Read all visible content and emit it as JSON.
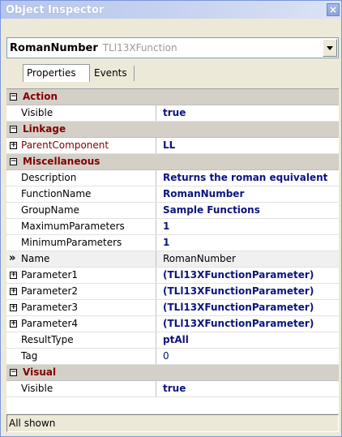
{
  "window": {
    "title": "Object Inspector"
  },
  "object_selector": {
    "name": "RomanNumber",
    "type": "TLl13XFunction"
  },
  "tabs": [
    {
      "label": "Properties"
    },
    {
      "label": "Events"
    }
  ],
  "rows": [
    {
      "kind": "category",
      "toggle": "−",
      "name": "Action"
    },
    {
      "kind": "prop",
      "name": "Visible",
      "value": "true",
      "style": "bold"
    },
    {
      "kind": "category",
      "toggle": "−",
      "name": "Linkage"
    },
    {
      "kind": "prop",
      "toggle": "+",
      "name": "ParentComponent",
      "value": "LL",
      "style": "bold",
      "link": true
    },
    {
      "kind": "category",
      "toggle": "−",
      "name": "Miscellaneous"
    },
    {
      "kind": "prop",
      "name": "Description",
      "value": "Returns the roman equivalent",
      "style": "bold"
    },
    {
      "kind": "prop",
      "name": "FunctionName",
      "value": "RomanNumber",
      "style": "bold"
    },
    {
      "kind": "prop",
      "name": "GroupName",
      "value": "Sample Functions",
      "style": "bold"
    },
    {
      "kind": "prop",
      "name": "MaximumParameters",
      "value": "1",
      "style": "bold"
    },
    {
      "kind": "prop",
      "name": "MinimumParameters",
      "value": "1",
      "style": "bold"
    },
    {
      "kind": "prop",
      "selected": true,
      "name": "Name",
      "value": "RomanNumber",
      "style": "plain"
    },
    {
      "kind": "prop",
      "toggle": "+",
      "name": "Parameter1",
      "value": "(TLl13XFunctionParameter)",
      "style": "bold"
    },
    {
      "kind": "prop",
      "toggle": "+",
      "name": "Parameter2",
      "value": "(TLl13XFunctionParameter)",
      "style": "bold"
    },
    {
      "kind": "prop",
      "toggle": "+",
      "name": "Parameter3",
      "value": "(TLl13XFunctionParameter)",
      "style": "bold"
    },
    {
      "kind": "prop",
      "toggle": "+",
      "name": "Parameter4",
      "value": "(TLl13XFunctionParameter)",
      "style": "bold"
    },
    {
      "kind": "prop",
      "name": "ResultType",
      "value": "ptAll",
      "style": "bold"
    },
    {
      "kind": "prop",
      "name": "Tag",
      "value": "0",
      "style": "num"
    },
    {
      "kind": "category",
      "toggle": "−",
      "name": "Visual"
    },
    {
      "kind": "prop",
      "name": "Visible",
      "value": "true",
      "style": "bold"
    }
  ],
  "selected_marker": "»",
  "status": {
    "text": "All shown"
  },
  "icons": {
    "close": "close-icon",
    "dropdown": "chevron-down-icon"
  },
  "colors": {
    "value": "#0b147e",
    "category": "#800000"
  }
}
